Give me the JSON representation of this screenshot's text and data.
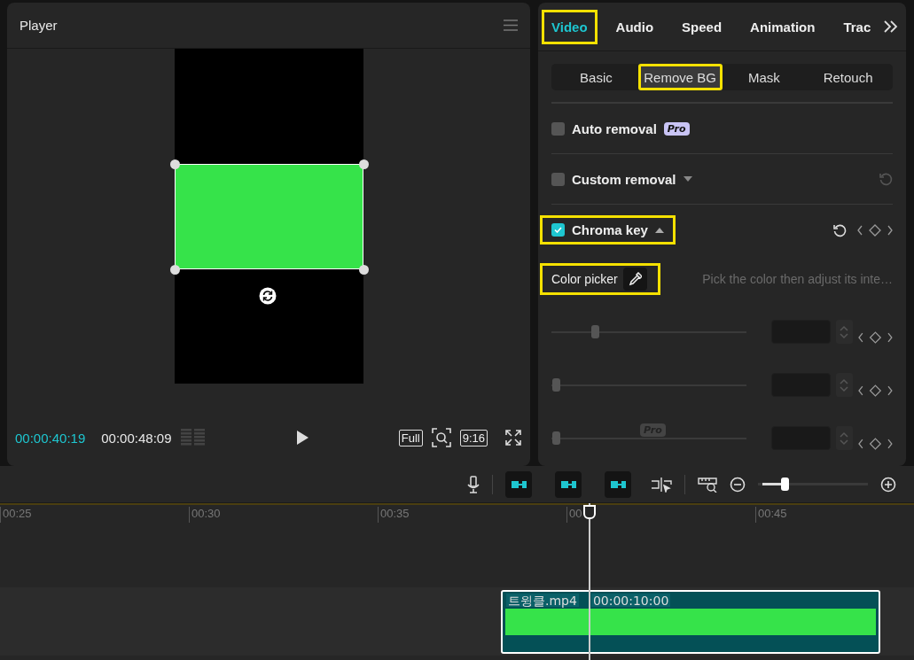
{
  "player": {
    "title": "Player",
    "current_time": "00:00:40:19",
    "duration": "00:00:48:09",
    "ratio_buttons": [
      "Full",
      "9:16"
    ]
  },
  "inspector": {
    "tabs": [
      {
        "label": "Video",
        "selected": true,
        "highlighted": true
      },
      {
        "label": "Audio",
        "selected": false,
        "highlighted": false
      },
      {
        "label": "Speed",
        "selected": false,
        "highlighted": false
      },
      {
        "label": "Animation",
        "selected": false,
        "highlighted": false
      },
      {
        "label": "Trac",
        "selected": false,
        "highlighted": false
      }
    ],
    "subtabs": [
      {
        "label": "Basic",
        "selected": false,
        "highlighted": false
      },
      {
        "label": "Remove BG",
        "selected": true,
        "highlighted": true
      },
      {
        "label": "Mask",
        "selected": false,
        "highlighted": false
      },
      {
        "label": "Retouch",
        "selected": false,
        "highlighted": false
      }
    ],
    "options": [
      {
        "label": "Auto removal",
        "checked": false,
        "badge": "Pro",
        "highlighted": false
      },
      {
        "label": "Custom removal",
        "checked": false,
        "expanded": false,
        "reset": true,
        "keyframe": false,
        "highlighted": false
      },
      {
        "label": "Chroma key",
        "checked": true,
        "expanded": true,
        "reset": true,
        "keyframe": true,
        "highlighted": true
      }
    ],
    "color_picker": {
      "label": "Color picker",
      "hint": "Pick the color then adjust its inte…",
      "highlighted": true
    },
    "sliders": [
      {
        "level": 0.21
      },
      {
        "level": 0
      },
      {
        "level": 0,
        "badge": "Pro"
      }
    ]
  },
  "timeline": {
    "zoom": {
      "level": 0.22
    },
    "ruler": [
      "00:25",
      "00:30",
      "00:35",
      "00",
      "00:45"
    ],
    "clip": {
      "name": "트윙클.mp4",
      "duration": "00:00:10:00"
    }
  }
}
